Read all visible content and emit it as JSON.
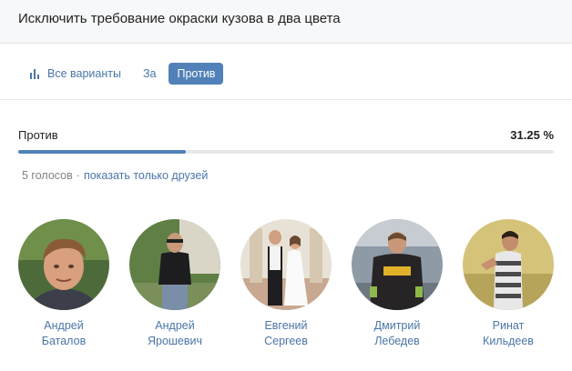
{
  "poll": {
    "question": "Исключить требование окраски кузова в два цвета"
  },
  "tabs": [
    {
      "label": "Все варианты",
      "icon": "bar-chart-icon"
    },
    {
      "label": "За"
    },
    {
      "label": "Против",
      "active": true
    }
  ],
  "result": {
    "label": "Против",
    "percent_label": "31.25 %",
    "percent_value": 31.25,
    "bar_color": "#5181b8"
  },
  "meta": {
    "votes": "5 голосов",
    "separator": "·",
    "friends_link": "показать только друзей"
  },
  "voters": [
    {
      "first": "Андрей",
      "last": "Баталов"
    },
    {
      "first": "Андрей",
      "last": "Ярошевич"
    },
    {
      "first": "Евгений",
      "last": "Сергеев"
    },
    {
      "first": "Дмитрий",
      "last": "Лебедев"
    },
    {
      "first": "Ринат",
      "last": "Кильдеев"
    }
  ],
  "colors": {
    "link": "#4a76a8",
    "accent": "#5181b8",
    "muted": "#828282",
    "header_bg": "#f7f8fa"
  }
}
